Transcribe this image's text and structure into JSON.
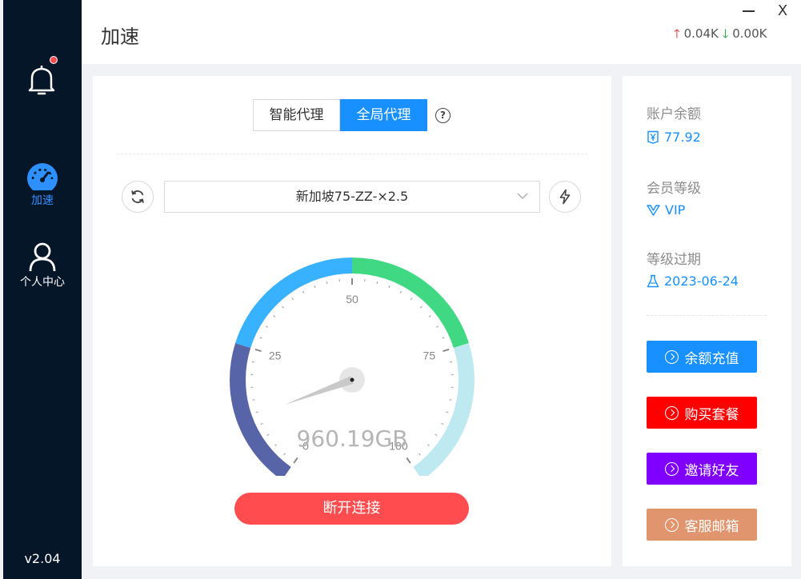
{
  "sidebar": {
    "items": [
      {
        "label": "加速"
      },
      {
        "label": "个人中心"
      }
    ],
    "version": "v2.04"
  },
  "header": {
    "title": "加速",
    "upload": "0.04K",
    "download": "0.00K",
    "close_label": "X"
  },
  "main": {
    "mode_options": [
      "智能代理",
      "全局代理"
    ],
    "selected_mode": "全局代理",
    "server": "新加坡75-ZZ-×2.5",
    "gauge": {
      "value": 12,
      "min": 0,
      "max": 100,
      "tick_labels": [
        "0",
        "25",
        "50",
        "75",
        "100"
      ],
      "readout": "960.19GB",
      "colors": [
        "#5765a8",
        "#38b2ff",
        "#41d883",
        "#bfe9f1"
      ]
    },
    "disconnect_label": "断开连接"
  },
  "account": {
    "balance_label": "账户余额",
    "balance_value": "77.92",
    "level_label": "会员等级",
    "level_value": "VIP",
    "expiry_label": "等级过期",
    "expiry_value": "2023-06-24"
  },
  "actions": [
    {
      "label": "余额充值",
      "color": "#1890ff"
    },
    {
      "label": "购买套餐",
      "color": "#ff0000"
    },
    {
      "label": "邀请好友",
      "color": "#8000ff"
    },
    {
      "label": "客服邮箱",
      "color": "#e0956e"
    }
  ]
}
